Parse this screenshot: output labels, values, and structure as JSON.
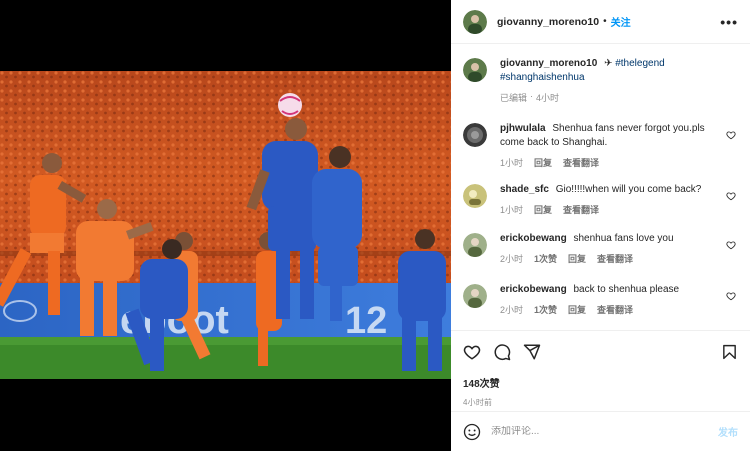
{
  "header": {
    "username": "giovanny_moreno10",
    "separator": "•",
    "follow_label": "关注",
    "more_label": "•••"
  },
  "caption": {
    "username": "giovanny_moreno10",
    "emoji": "✈",
    "hashtag1": "#thelegend",
    "hashtag2": "#shanghaishenhua",
    "edited": "已编辑",
    "dot": "·",
    "time": "4小时"
  },
  "comments": [
    {
      "username": "pjhwulala",
      "text": "Shenhua fans never forgot you.pls come back to Shanghai.",
      "time": "1小时",
      "likes": "",
      "reply": "回复",
      "translate": "查看翻译"
    },
    {
      "username": "shade_sfc",
      "text": "Gio!!!!!when will you come back?",
      "time": "1小时",
      "likes": "",
      "reply": "回复",
      "translate": "查看翻译"
    },
    {
      "username": "erickobewang",
      "text": "shenhua fans love you",
      "time": "2小时",
      "likes": "1次赞",
      "reply": "回复",
      "translate": "查看翻译"
    },
    {
      "username": "erickobewang",
      "text": "back to shenhua please",
      "time": "2小时",
      "likes": "1次赞",
      "reply": "回复",
      "translate": "查看翻译"
    }
  ],
  "post": {
    "likes": "148次赞",
    "time_ago": "4小时前"
  },
  "add_comment": {
    "placeholder": "添加评论...",
    "post_label": "发布"
  },
  "colors": {
    "accent": "#0095f6",
    "hashtag": "#00376b",
    "muted": "#8e8e8e"
  }
}
